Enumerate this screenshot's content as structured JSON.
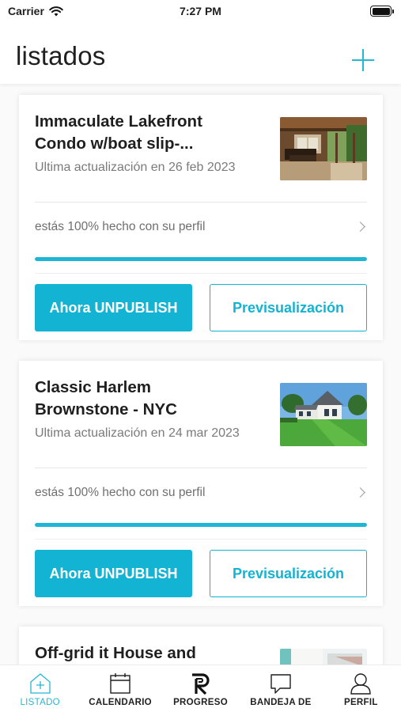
{
  "status_bar": {
    "carrier": "Carrier",
    "time": "7:27 PM"
  },
  "header": {
    "title": "listados",
    "add_icon": "plus-icon"
  },
  "accent_color": "#12b3d3",
  "listings": [
    {
      "title": "Immaculate Lakefront Condo w/boat slip-...",
      "updated": "Ultima actualización en 26 feb 2023",
      "progress_text": "estás 100% hecho con su perfil",
      "progress_percent": 100,
      "unpublish_label": "Ahora UNPUBLISH",
      "preview_label": "Previsualización",
      "image": "patio-photo"
    },
    {
      "title": "Classic Harlem Brownstone - NYC",
      "updated": "Ultima actualización en 24 mar 2023",
      "progress_text": "estás 100% hecho con su perfil",
      "progress_percent": 100,
      "unpublish_label": "Ahora UNPUBLISH",
      "preview_label": "Previsualización",
      "image": "house-lawn-photo"
    },
    {
      "title": "Off-grid it House and",
      "image": "interior-photo"
    }
  ],
  "tabs": [
    {
      "label": "LISTADO",
      "icon": "house-plus-icon",
      "active": true
    },
    {
      "label": "CALENDARIO",
      "icon": "calendar-icon",
      "active": false
    },
    {
      "label": "PROGRESO",
      "icon": "progress-r-icon",
      "active": false
    },
    {
      "label": "BANDEJA DE",
      "icon": "chat-bubble-icon",
      "active": false
    },
    {
      "label": "PERFIL",
      "icon": "person-icon",
      "active": false
    }
  ]
}
